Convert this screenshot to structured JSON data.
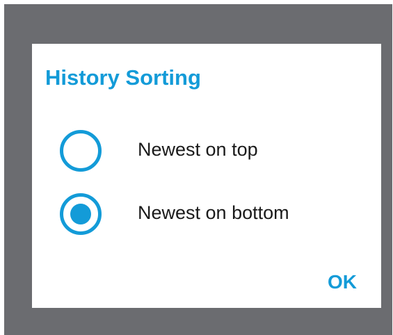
{
  "dialog": {
    "title": "History Sorting",
    "options": [
      {
        "label": "Newest on top",
        "selected": false
      },
      {
        "label": "Newest on bottom",
        "selected": true
      }
    ],
    "confirm_label": "OK"
  },
  "colors": {
    "accent": "#139bd8",
    "scrim": "#6b6c70",
    "dialog_bg": "#ffffff",
    "text": "#1a1a1a"
  },
  "icons": {
    "unselected_radio": "radio-unselected-icon",
    "selected_radio": "radio-selected-icon"
  }
}
